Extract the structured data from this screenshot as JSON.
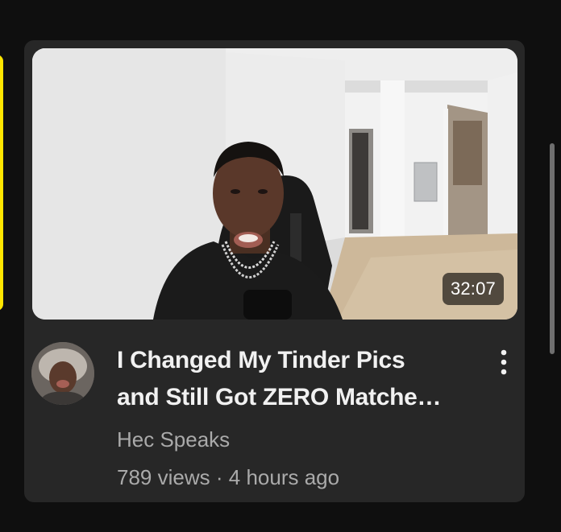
{
  "video": {
    "title_line1": "I Changed My Tinder Pics",
    "title_line2": "and Still Got ZERO Matche…",
    "duration": "32:07",
    "channel": "Hec Speaks",
    "views": "789 views",
    "separator": "·",
    "age": "4 hours ago"
  },
  "icons": {
    "more": "more-vertical-icon"
  },
  "colors": {
    "background": "#0f0f0f",
    "card": "#272727",
    "title_text": "#f1f1f1",
    "secondary_text": "#aaaaaa",
    "adjacent_card_accent": "#ffe600"
  }
}
